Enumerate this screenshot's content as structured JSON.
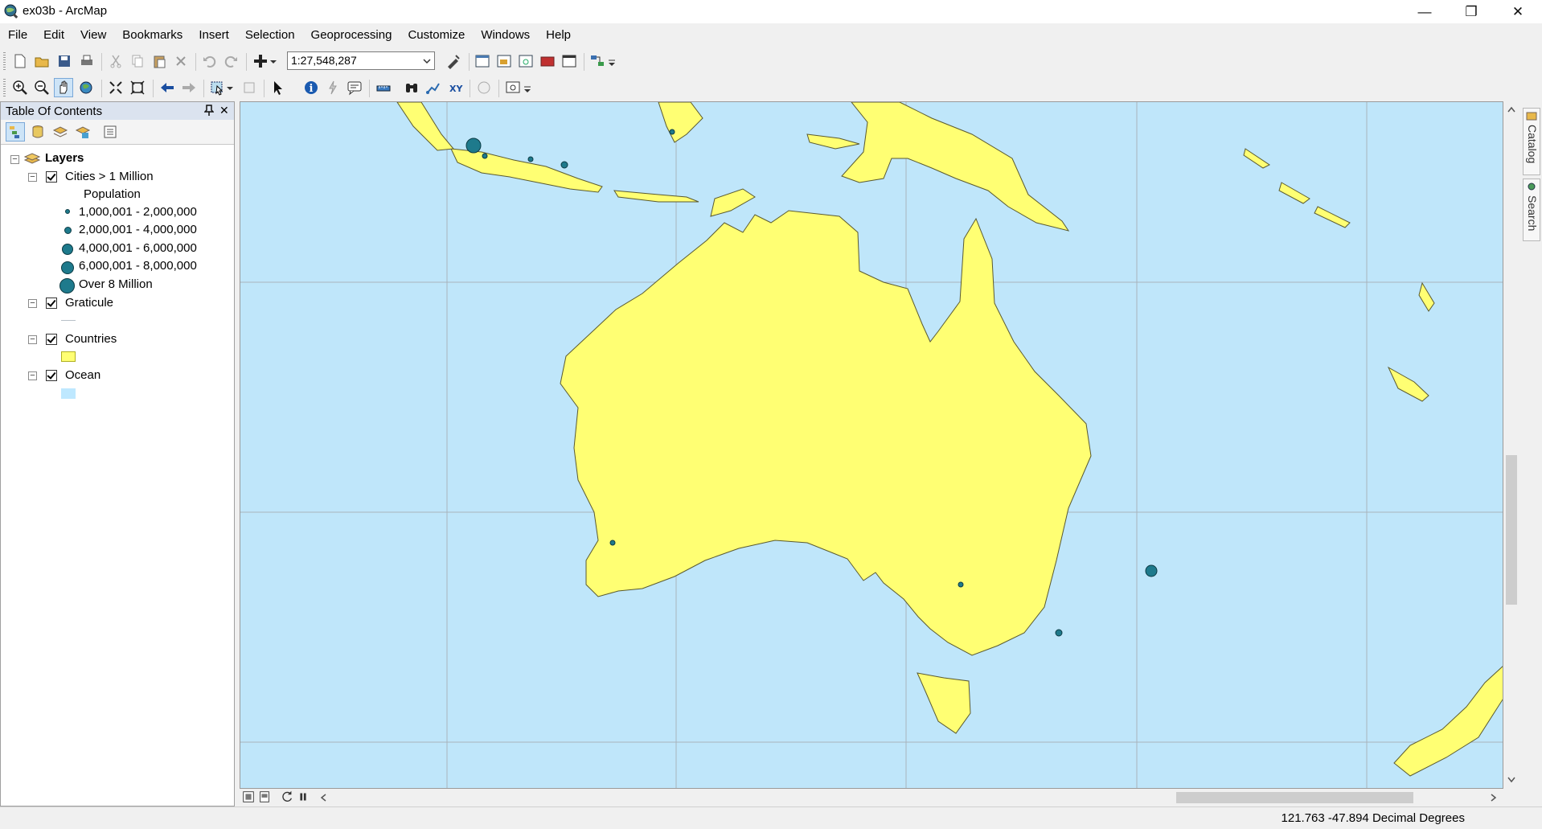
{
  "window": {
    "title": "ex03b - ArcMap",
    "minimize_glyph": "—",
    "restore_glyph": "❐",
    "close_glyph": "✕"
  },
  "menu": [
    "File",
    "Edit",
    "View",
    "Bookmarks",
    "Insert",
    "Selection",
    "Geoprocessing",
    "Customize",
    "Windows",
    "Help"
  ],
  "toolbar": {
    "scale_value": "1:27,548,287"
  },
  "toc": {
    "title": "Table Of Contents",
    "pin_glyph": "📌",
    "close_glyph": "✕",
    "data_frame": "Layers",
    "layers": {
      "cities": {
        "name": "Cities > 1 Million",
        "field": "Population",
        "classes": [
          "1,000,001 - 2,000,000",
          "2,000,001 - 4,000,000",
          "4,000,001 - 6,000,000",
          "6,000,001 - 8,000,000",
          "Over 8 Million"
        ]
      },
      "graticule": {
        "name": "Graticule"
      },
      "countries": {
        "name": "Countries",
        "color": "#ffff73"
      },
      "ocean": {
        "name": "Ocean",
        "color": "#bee8ff"
      }
    }
  },
  "colors": {
    "land": "#ffff73",
    "ocean": "#bfe6fa",
    "graticule": "#a8b4bc",
    "city_fill": "#1e7a8c"
  },
  "dock": {
    "catalog": "Catalog",
    "search": "Search"
  },
  "status": {
    "coordinates": "121.763  -47.894 Decimal Degrees"
  }
}
